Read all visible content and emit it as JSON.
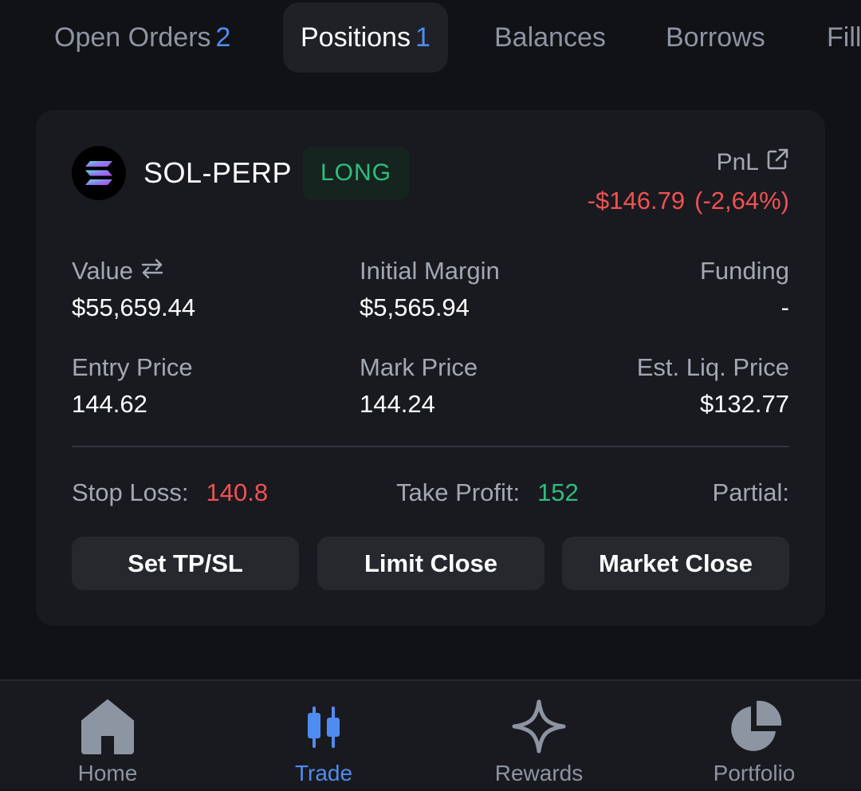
{
  "tabs": [
    {
      "label": "Open Orders",
      "count": "2"
    },
    {
      "label": "Positions",
      "count": "1"
    },
    {
      "label": "Balances"
    },
    {
      "label": "Borrows"
    },
    {
      "label": "Fills"
    }
  ],
  "position": {
    "market": "SOL-PERP",
    "side": "LONG",
    "pnl_label": "PnL",
    "pnl_value": "-$146.79",
    "pnl_percent": "(-2,64%)",
    "value_label": "Value",
    "value": "$55,659.44",
    "initial_margin_label": "Initial Margin",
    "initial_margin": "$5,565.94",
    "funding_label": "Funding",
    "funding": "-",
    "entry_price_label": "Entry Price",
    "entry_price": "144.62",
    "mark_price_label": "Mark Price",
    "mark_price": "144.24",
    "liq_price_label": "Est. Liq. Price",
    "liq_price": "$132.77",
    "stop_loss_label": "Stop Loss:",
    "stop_loss": "140.8",
    "take_profit_label": "Take Profit:",
    "take_profit": "152",
    "partial_label": "Partial:"
  },
  "actions": {
    "set_tpsl": "Set TP/SL",
    "limit_close": "Limit Close",
    "market_close": "Market Close"
  },
  "nav": {
    "home": "Home",
    "trade": "Trade",
    "rewards": "Rewards",
    "portfolio": "Portfolio"
  },
  "colors": {
    "background": "#111216",
    "card": "#191a1f",
    "accent_blue": "#4f8cf0",
    "profit_green": "#2fbe7f",
    "loss_red": "#f05252"
  },
  "icons": {
    "logo": "solana-logo-icon",
    "pnl_share": "external-link-icon",
    "value_toggle": "swap-arrows-icon",
    "home": "home-icon",
    "trade": "candlestick-icon",
    "rewards": "sparkle-star-icon",
    "portfolio": "pie-chart-icon"
  }
}
